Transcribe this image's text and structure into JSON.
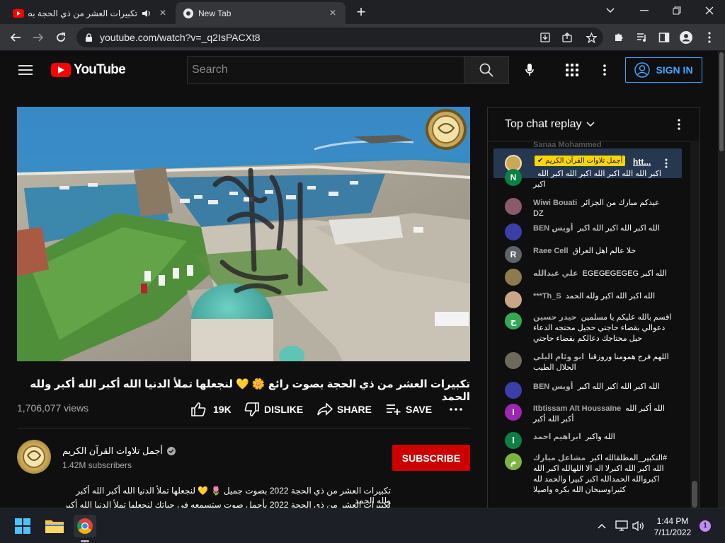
{
  "browser": {
    "tabs": [
      {
        "title": "تكبيرات العشر من ذي الحجة بص",
        "active": false
      },
      {
        "title": "New Tab",
        "active": true
      }
    ],
    "url": "youtube.com/watch?v=_q2IsPACXt8"
  },
  "youtube": {
    "logo_text": "YouTube",
    "search_placeholder": "Search",
    "signin_label": "SIGN IN"
  },
  "video": {
    "watermark": "تلاوات القرآن الكريم",
    "title": "تكبيرات العشر من ذي الحجة بصوت رائع 🌼 💛 لنجعلها تملأ الدنيا الله أكبر الله أكبر ولله الحمد",
    "views": "1,706,077 views",
    "likes": "19K",
    "dislike_label": "DISLIKE",
    "share_label": "SHARE",
    "save_label": "SAVE"
  },
  "channel": {
    "name": "أجمل تلاوات القرآن الكريم",
    "subscribers": "1.42M subscribers",
    "subscribe_label": "SUBSCRIBE"
  },
  "description": [
    "تكبيرات العشر من ذي الحجة 2022 بصوت جميل 🌷 💛 لنجعلها تملأ الدنيا الله أكبر الله أكبر ولله الحمد",
    "تكبيرات العشر من ذي الحجة 2022 بأجمل صوت ستسمعه في حياتك لنجعلها تملأ الدنيا الله أكبر الله أكبر"
  ],
  "chat": {
    "header": "Top chat replay",
    "faded_author": "Sanaa Mohammed",
    "pinned": {
      "author": "أجمل تلاوات القرآن الكريم ✔",
      "text": "htt..."
    },
    "messages": [
      {
        "author": "",
        "text": "اكبر الله الله اكبر الله اكبر الله اكبر الله اكبر",
        "initial": "N",
        "color": "#0b8043"
      },
      {
        "author": "Wiwi Bouati",
        "text": "عيدكم مبارك من الجزائر DZ",
        "initial": "",
        "color": "#8a5a6a"
      },
      {
        "author": "BEN أويس",
        "text": "الله اكبر الله اكبر الله اكبر",
        "initial": "",
        "color": "#3a3fa8"
      },
      {
        "author": "Raee Cell",
        "text": "حلا عالم اهل العراق",
        "initial": "R",
        "color": "#5f6368"
      },
      {
        "author": "علي عبدالله",
        "text": "EGEGEGEGEG الله اكبر",
        "initial": "",
        "color": "#8d7a4f"
      },
      {
        "author": "***Th_S",
        "text": "الله اكبر الله اكبر ولله الحمد",
        "initial": "",
        "color": "#c9a58a"
      },
      {
        "author": "حيدر حسين",
        "text": "اقسم بالله عليكم يا مسلمين دعوالي بقضاء حاجتي حجيل محتجه الدعاء حيل محتاجك دعالكم بقضاء حاجتي",
        "initial": "ح",
        "color": "#34a853"
      },
      {
        "author": "ابو وئام البلي",
        "text": "اللهم فرج همومنا وروزقنا الحلال الطيب",
        "initial": "",
        "color": "#6d6a5a"
      },
      {
        "author": "BEN أويس",
        "text": "الله اكبر الله اكبر الله اكبر",
        "initial": "",
        "color": "#3a3fa8"
      },
      {
        "author": "Itbtissam Aït Houssaïne",
        "text": "الله أكبر الله أكبر الله أكبر",
        "initial": "I",
        "color": "#9c27b0"
      },
      {
        "author": "ابراهيم احمد",
        "text": "الله واكبر",
        "initial": "ا",
        "color": "#0b8043"
      },
      {
        "author": "مشاعل مبارك",
        "text": "#التكبير_المطلقالله اكبر الله اكبر الله اكبرلا اله الا اللهالله اكبر الله اكبروالله الحمدالله اكبر كبيرا والحمد لله كثيراوسبحان الله بكره واصيلا",
        "initial": "م",
        "color": "#7cb342"
      }
    ]
  },
  "taskbar": {
    "time": "1:44 PM",
    "date": "7/11/2022",
    "notifications": "1"
  }
}
